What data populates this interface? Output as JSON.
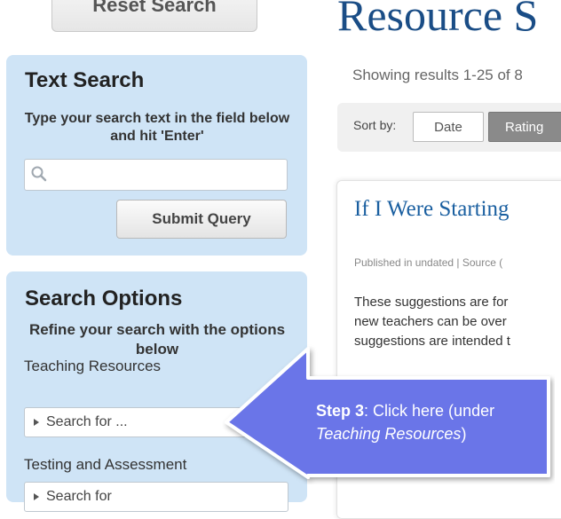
{
  "sidebar": {
    "reset_button": "Reset Search",
    "text_search": {
      "title": "Text Search",
      "instructions": "Type your search text in the field below and hit 'Enter'",
      "input_value": "",
      "submit_label": "Submit Query"
    },
    "search_options": {
      "title": "Search Options",
      "subtitle": "Refine your search with the options below",
      "groups": [
        {
          "label": "Teaching Resources",
          "select_text": "Search for ..."
        },
        {
          "label": "Testing and Assessment",
          "select_text": "Search for"
        }
      ]
    }
  },
  "main": {
    "page_title": "Resource S",
    "showing": "Showing results 1-25 of 8",
    "sort": {
      "label": "Sort by:",
      "options": [
        "Date",
        "Rating"
      ],
      "active": "Rating"
    },
    "result": {
      "title": "If I Were Starting",
      "meta": "Published in undated | Source (",
      "desc_lines": [
        "These suggestions are for",
        "new teachers can be over",
        "suggestions are intended t"
      ]
    }
  },
  "callout": {
    "step": "Step 3",
    "text": ": Click here (under",
    "italic": "Teaching Resources",
    "end": ")",
    "fill_color": "#6a75e8",
    "border_color": "#ffffff"
  }
}
